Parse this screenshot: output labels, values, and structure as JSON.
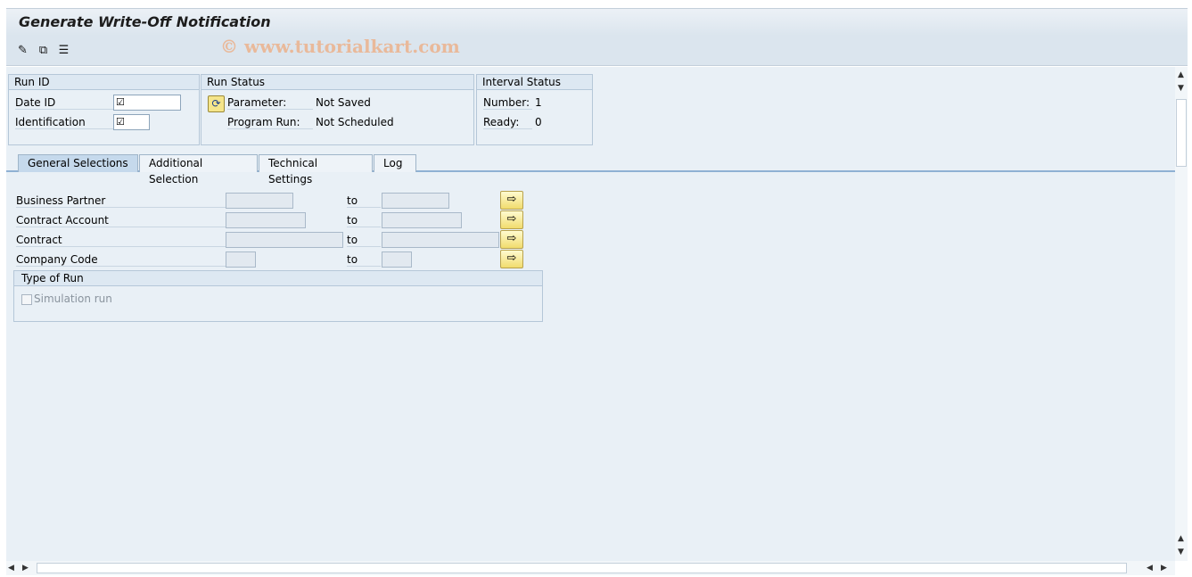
{
  "window": {
    "title": "Generate Write-Off Notification",
    "watermark": "© www.tutorialkart.com"
  },
  "toolbar": {
    "icons": [
      "edit-variant-icon",
      "copy-icon",
      "list-icon"
    ]
  },
  "run_id": {
    "header": "Run ID",
    "date_id_label": "Date ID",
    "identification_label": "Identification",
    "checkmark": "☑"
  },
  "run_status": {
    "header": "Run Status",
    "parameter_label": "Parameter:",
    "parameter_value": "Not Saved",
    "program_run_label": "Program Run:",
    "program_run_value": "Not Scheduled"
  },
  "interval_status": {
    "header": "Interval Status",
    "number_label": "Number:",
    "number_value": "1",
    "ready_label": "Ready:",
    "ready_value": "0"
  },
  "tabs": [
    {
      "label": "General Selections",
      "active": true
    },
    {
      "label": "Additional Selection",
      "active": false
    },
    {
      "label": "Technical Settings",
      "active": false
    },
    {
      "label": "Log",
      "active": false
    }
  ],
  "selections": {
    "to_label": "to",
    "rows": [
      {
        "label": "Business Partner"
      },
      {
        "label": "Contract Account"
      },
      {
        "label": "Contract"
      },
      {
        "label": "Company Code"
      }
    ]
  },
  "type_of_run": {
    "header": "Type of Run",
    "simulation_label": "Simulation run",
    "simulation_checked": false
  },
  "colors": {
    "content_bg": "#e9f0f6",
    "title_bg": "#dbe5ee",
    "arrow_button": "#f1dc6d"
  }
}
